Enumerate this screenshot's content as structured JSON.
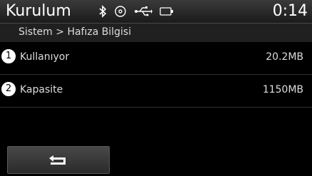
{
  "header": {
    "title": "Kurulum",
    "clock": "0:14",
    "status_icons": [
      "bluetooth-icon",
      "disc-icon",
      "usb-icon",
      "battery-icon"
    ]
  },
  "breadcrumb": "Sistem > Hafıza Bilgisi",
  "memory": {
    "used": {
      "callout": "1",
      "label": "Kullanıyor",
      "value": "20.2MB"
    },
    "capacity": {
      "callout": "2",
      "label": "Kapasite",
      "value": "1150MB"
    }
  },
  "footer": {
    "back_icon": "return-arrow-icon"
  }
}
